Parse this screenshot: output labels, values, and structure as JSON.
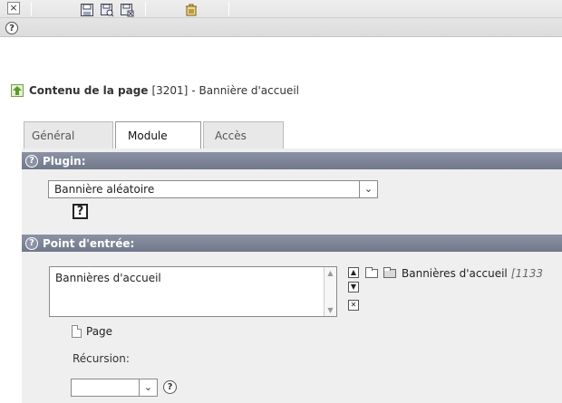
{
  "toolbar": {
    "close_label": "×",
    "icons": [
      "save-icon",
      "save-and-view-icon",
      "save-and-close-icon",
      "delete-icon"
    ],
    "help_label": "?"
  },
  "header": {
    "title": "Contenu de la page",
    "uid": "[3201]",
    "subtitle": "- Bannière d'accueil"
  },
  "tabs": [
    {
      "label": "Général"
    },
    {
      "label": "Module"
    },
    {
      "label": "Accès"
    }
  ],
  "plugin": {
    "section_label": "Plugin:",
    "help_label": "?",
    "selected": "Bannière aléatoire",
    "arrow": "⌄",
    "icon_label": "?"
  },
  "entry": {
    "section_label": "Point d'entrée:",
    "help_label": "?",
    "list_items": [
      "Bannières d'accueil"
    ],
    "folder_label": "Bannières d'accueil",
    "folder_uid": "[1133",
    "page_label": "Page",
    "recursion_label": "Récursion:",
    "recursion_value": "",
    "recursion_help": "?"
  },
  "colors": {
    "section_bar": "#7d8598",
    "form_bg": "#efefef",
    "toolbar_bg": "#e4e4e4"
  }
}
